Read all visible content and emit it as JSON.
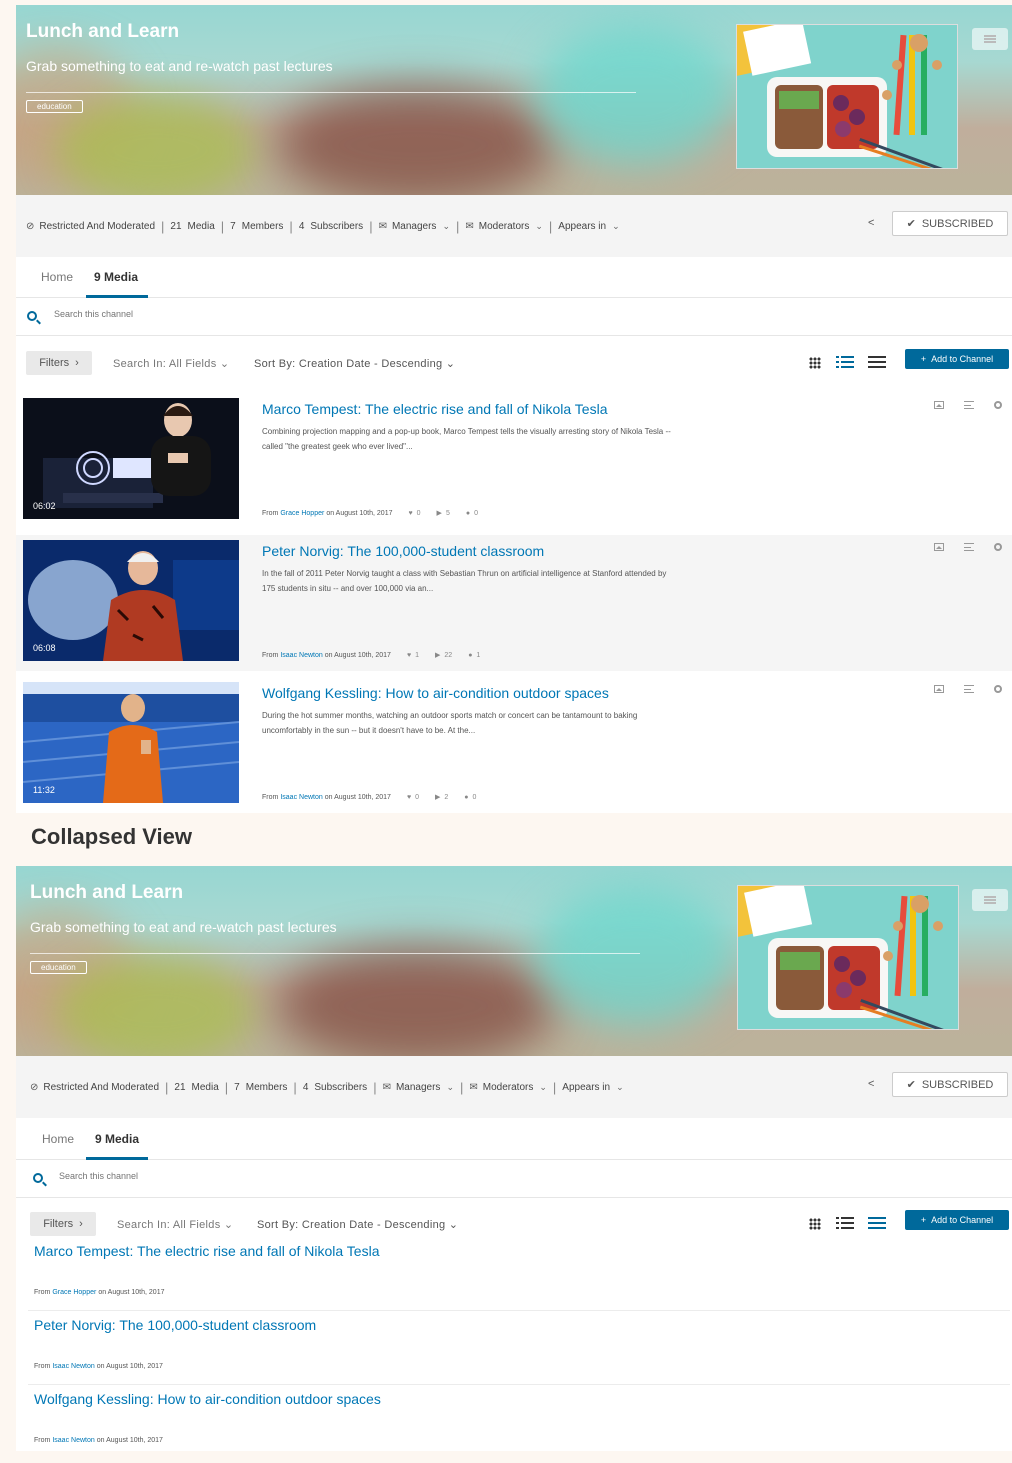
{
  "channel": {
    "title": "Lunch and Learn",
    "subtitle": "Grab something to eat and re-watch past lectures",
    "tag": "education"
  },
  "info": {
    "restriction": "Restricted And Moderated",
    "media_count": "21",
    "media_label": "Media",
    "members_count": "7",
    "members_label": "Members",
    "subscribers_count": "4",
    "subscribers_label": "Subscribers",
    "managers_label": "Managers",
    "moderators_label": "Moderators",
    "appears_in_label": "Appears in",
    "subscribed_label": "SUBSCRIBED"
  },
  "tabs": {
    "home": "Home",
    "media": "9 Media"
  },
  "search": {
    "placeholder": "Search this channel"
  },
  "toolbar": {
    "filters": "Filters",
    "search_in": "Search In: All Fields",
    "sort_by": "Sort By: Creation Date - Descending",
    "add_to_channel": "Add to Channel"
  },
  "media": [
    {
      "title": "Marco Tempest: The electric rise and fall of Nikola Tesla",
      "description": "Combining projection mapping and a pop-up book, Marco Tempest tells the visually arresting story of Nikola Tesla -- called \"the greatest geek who ever lived\"...",
      "duration": "06:02",
      "from_label": "From",
      "author": "Grace Hopper",
      "date": "on August 10th, 2017",
      "likes": "0",
      "plays": "5",
      "comments": "0"
    },
    {
      "title": "Peter Norvig: The 100,000-student classroom",
      "description": "In the fall of 2011 Peter Norvig taught a class with Sebastian Thrun on artificial intelligence at Stanford attended by 175 students in situ -- and over 100,000 via an...",
      "duration": "06:08",
      "from_label": "From",
      "author": "Isaac Newton",
      "date": "on August 10th, 2017",
      "likes": "1",
      "plays": "22",
      "comments": "1"
    },
    {
      "title": "Wolfgang Kessling: How to air-condition outdoor spaces",
      "description": "During the hot summer months, watching an outdoor sports match or concert can be tantamount to baking uncomfortably in the sun -- but it doesn't have to be. At the...",
      "duration": "11:32",
      "from_label": "From",
      "author": "Isaac Newton",
      "date": "on August 10th, 2017",
      "likes": "0",
      "plays": "2",
      "comments": "0"
    }
  ],
  "collapsed_heading": "Collapsed View",
  "colors": {
    "accent": "#00699b",
    "link": "#0077b5"
  }
}
